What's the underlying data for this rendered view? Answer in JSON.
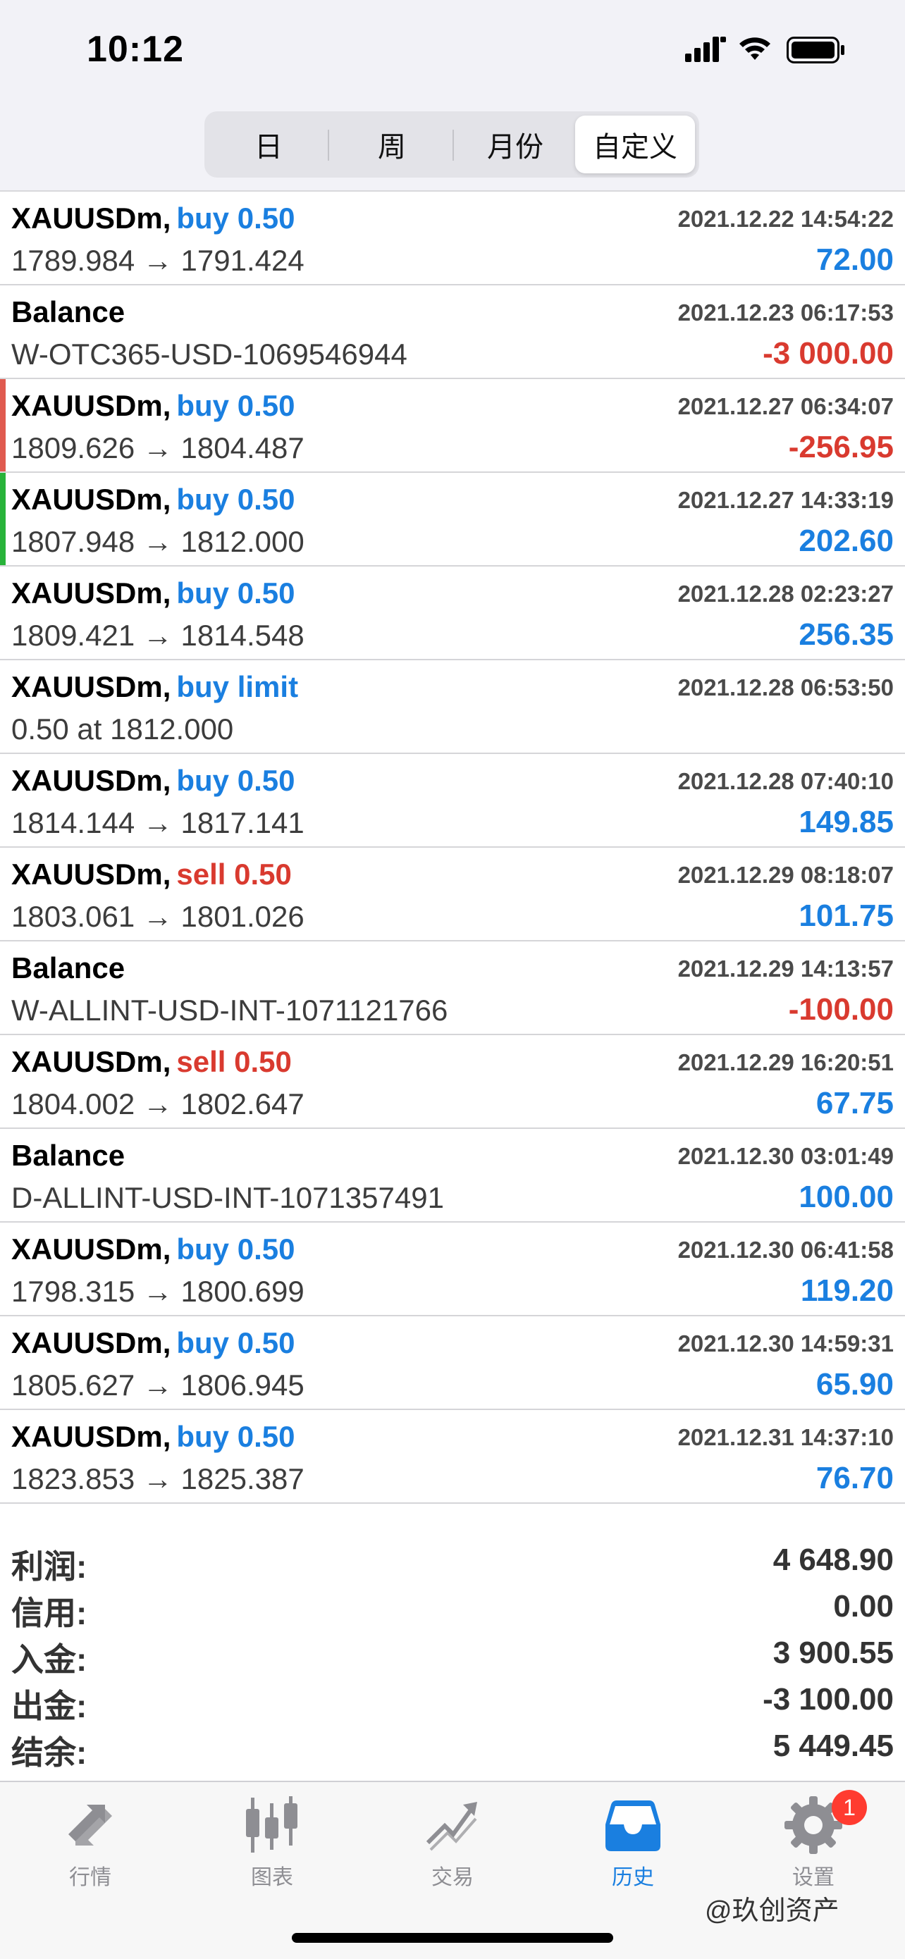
{
  "status": {
    "time": "10:12"
  },
  "segments": [
    "日",
    "周",
    "月份",
    "自定义"
  ],
  "segment_active_index": 3,
  "rows": [
    {
      "symbol": "XAUUSDm,",
      "action": "buy 0.50",
      "type": "buy",
      "sub": "1789.984 → 1791.424",
      "date": "2021.12.22 14:54:22",
      "profit": "72.00",
      "sign": "pos",
      "bar": ""
    },
    {
      "symbol": "Balance",
      "action": "",
      "type": "",
      "sub": "W-OTC365-USD-1069546944",
      "date": "2021.12.23 06:17:53",
      "profit": "-3 000.00",
      "sign": "neg",
      "bar": ""
    },
    {
      "symbol": "XAUUSDm,",
      "action": "buy 0.50",
      "type": "buy",
      "sub": "1809.626 → 1804.487",
      "date": "2021.12.27 06:34:07",
      "profit": "-256.95",
      "sign": "neg",
      "bar": "#e05a4f"
    },
    {
      "symbol": "XAUUSDm,",
      "action": "buy 0.50",
      "type": "buy",
      "sub": "1807.948 → 1812.000",
      "date": "2021.12.27 14:33:19",
      "profit": "202.60",
      "sign": "pos",
      "bar": "#28b33a"
    },
    {
      "symbol": "XAUUSDm,",
      "action": "buy 0.50",
      "type": "buy",
      "sub": "1809.421 → 1814.548",
      "date": "2021.12.28 02:23:27",
      "profit": "256.35",
      "sign": "pos",
      "bar": ""
    },
    {
      "symbol": "XAUUSDm,",
      "action": "buy limit",
      "type": "buy",
      "sub": "0.50 at 1812.000",
      "date": "2021.12.28 06:53:50",
      "profit": "",
      "sign": "pos",
      "bar": ""
    },
    {
      "symbol": "XAUUSDm,",
      "action": "buy 0.50",
      "type": "buy",
      "sub": "1814.144 → 1817.141",
      "date": "2021.12.28 07:40:10",
      "profit": "149.85",
      "sign": "pos",
      "bar": ""
    },
    {
      "symbol": "XAUUSDm,",
      "action": "sell 0.50",
      "type": "sell",
      "sub": "1803.061 → 1801.026",
      "date": "2021.12.29 08:18:07",
      "profit": "101.75",
      "sign": "pos",
      "bar": ""
    },
    {
      "symbol": "Balance",
      "action": "",
      "type": "",
      "sub": "W-ALLINT-USD-INT-1071121766",
      "date": "2021.12.29 14:13:57",
      "profit": "-100.00",
      "sign": "neg",
      "bar": ""
    },
    {
      "symbol": "XAUUSDm,",
      "action": "sell 0.50",
      "type": "sell",
      "sub": "1804.002 → 1802.647",
      "date": "2021.12.29 16:20:51",
      "profit": "67.75",
      "sign": "pos",
      "bar": ""
    },
    {
      "symbol": "Balance",
      "action": "",
      "type": "",
      "sub": "D-ALLINT-USD-INT-1071357491",
      "date": "2021.12.30 03:01:49",
      "profit": "100.00",
      "sign": "pos",
      "bar": ""
    },
    {
      "symbol": "XAUUSDm,",
      "action": "buy 0.50",
      "type": "buy",
      "sub": "1798.315 → 1800.699",
      "date": "2021.12.30 06:41:58",
      "profit": "119.20",
      "sign": "pos",
      "bar": ""
    },
    {
      "symbol": "XAUUSDm,",
      "action": "buy 0.50",
      "type": "buy",
      "sub": "1805.627 → 1806.945",
      "date": "2021.12.30 14:59:31",
      "profit": "65.90",
      "sign": "pos",
      "bar": ""
    },
    {
      "symbol": "XAUUSDm,",
      "action": "buy 0.50",
      "type": "buy",
      "sub": "1823.853 → 1825.387",
      "date": "2021.12.31 14:37:10",
      "profit": "76.70",
      "sign": "pos",
      "bar": ""
    }
  ],
  "summary": [
    {
      "label": "利润:",
      "value": "4 648.90"
    },
    {
      "label": "信用:",
      "value": "0.00"
    },
    {
      "label": "入金:",
      "value": "3 900.55"
    },
    {
      "label": "出金:",
      "value": "-3 100.00"
    },
    {
      "label": "结余:",
      "value": "5 449.45"
    }
  ],
  "tabs": [
    {
      "label": "行情",
      "icon": "quotes-icon"
    },
    {
      "label": "图表",
      "icon": "chart-icon"
    },
    {
      "label": "交易",
      "icon": "trade-icon"
    },
    {
      "label": "历史",
      "icon": "history-icon"
    },
    {
      "label": "设置",
      "icon": "settings-icon"
    }
  ],
  "tab_active_index": 3,
  "settings_badge": "1",
  "watermark": "@玖创资产",
  "colors": {
    "blue": "#1a7fe0",
    "red": "#d93a2f",
    "green": "#28b33a",
    "gray_icon": "#8e8e93"
  }
}
